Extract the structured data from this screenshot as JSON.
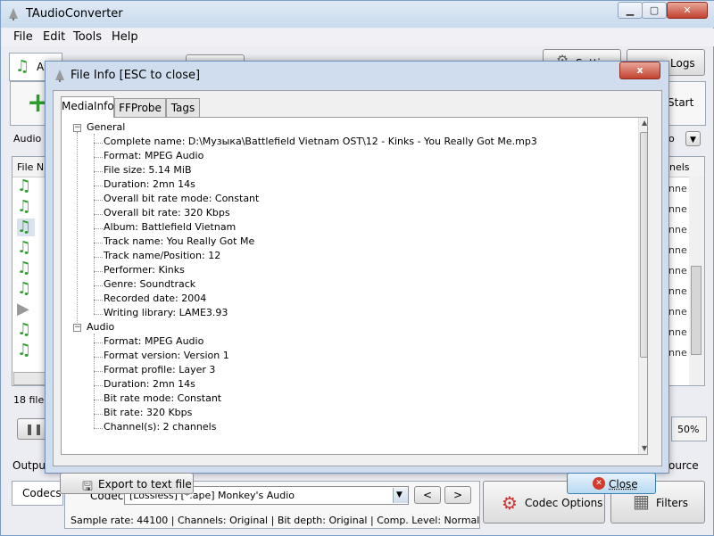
{
  "app": {
    "title": "TAudioConverter"
  },
  "menu": [
    "File",
    "Edit",
    "Tools",
    "Help"
  ],
  "main": {
    "tab_label": "Aud",
    "settings_label": "Setti",
    "logs_label": "Logs",
    "start_label": "Start",
    "audio_track_label": "Audio tr",
    "audio_track_value": "o",
    "file_col_header": "File Na",
    "channels_col_header": "nels",
    "channels_cell": "nne",
    "file_count": "18 file(s",
    "progress_percent": "50%",
    "output_label": "Output:",
    "source_label": "ource",
    "codecs_tab": "Codecs",
    "codec_label": "Codec:",
    "codec_value": "[Lossless] [*.ape] Monkey's Audio",
    "prev_button": "<",
    "next_button": ">",
    "codec_options_button": "Codec Options",
    "filters_button": "Filters",
    "status_line": "Sample rate: 44100 | Channels: Original | Bit depth: Original | Comp. Level: Normal"
  },
  "dialog": {
    "title": "File Info [ESC to close]",
    "close_x": "x",
    "tabs": [
      "MediaInfo",
      "FFProbe",
      "Tags"
    ],
    "sections": [
      {
        "name": "General",
        "items": [
          "Complete name: D:\\Музыка\\Battlefield Vietnam OST\\12 - Kinks - You Really Got Me.mp3",
          "Format: MPEG Audio",
          "File size: 5.14 MiB",
          "Duration: 2mn 14s",
          "Overall bit rate mode: Constant",
          "Overall bit rate: 320 Kbps",
          "Album: Battlefield Vietnam",
          "Track name: You Really Got Me",
          "Track name/Position: 12",
          "Performer: Kinks",
          "Genre: Soundtrack",
          "Recorded date: 2004",
          "Writing library: LAME3.93"
        ]
      },
      {
        "name": "Audio",
        "items": [
          "Format: MPEG Audio",
          "Format version: Version 1",
          "Format profile: Layer 3",
          "Duration: 2mn 14s",
          "Bit rate mode: Constant",
          "Bit rate: 320 Kbps",
          "Channel(s): 2 channels"
        ]
      }
    ],
    "export_button": "Export to text file",
    "close_button": "Close"
  }
}
